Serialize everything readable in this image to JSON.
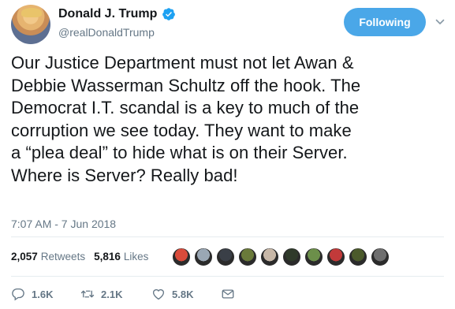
{
  "user": {
    "display_name": "Donald J. Trump",
    "handle": "@realDonaldTrump"
  },
  "follow_button": {
    "label": "Following"
  },
  "tweet": {
    "lines": [
      "Our Justice Department must not let Awan &",
      "Debbie Wasserman Schultz off the hook. The",
      "Democrat I.T. scandal is a key to much of the",
      "corruption we see today. They want to make",
      "a “plea deal” to hide what is on their Server.",
      "Where is Server? Really bad!"
    ],
    "timestamp": "7:07 AM - 7 Jun 2018"
  },
  "stats": {
    "retweets_count": "2,057",
    "retweets_label": "Retweets",
    "likes_count": "5,816",
    "likes_label": "Likes"
  },
  "liker_colors": [
    "#d94b3b",
    "#9aa7b4",
    "#3a3f47",
    "#6a7a3a",
    "#c8b8a8",
    "#2f3a2a",
    "#6c8f4a",
    "#c23a3a",
    "#4b5a2b",
    "#6e6e6e",
    "#b89478",
    "#8f6e5a"
  ],
  "actions": {
    "reply_count": "1.6K",
    "retweet_count": "2.1K",
    "like_count": "5.8K"
  },
  "colors": {
    "accent": "#1da1f2",
    "follow_bg": "#4aa7e8",
    "muted": "#657786"
  }
}
